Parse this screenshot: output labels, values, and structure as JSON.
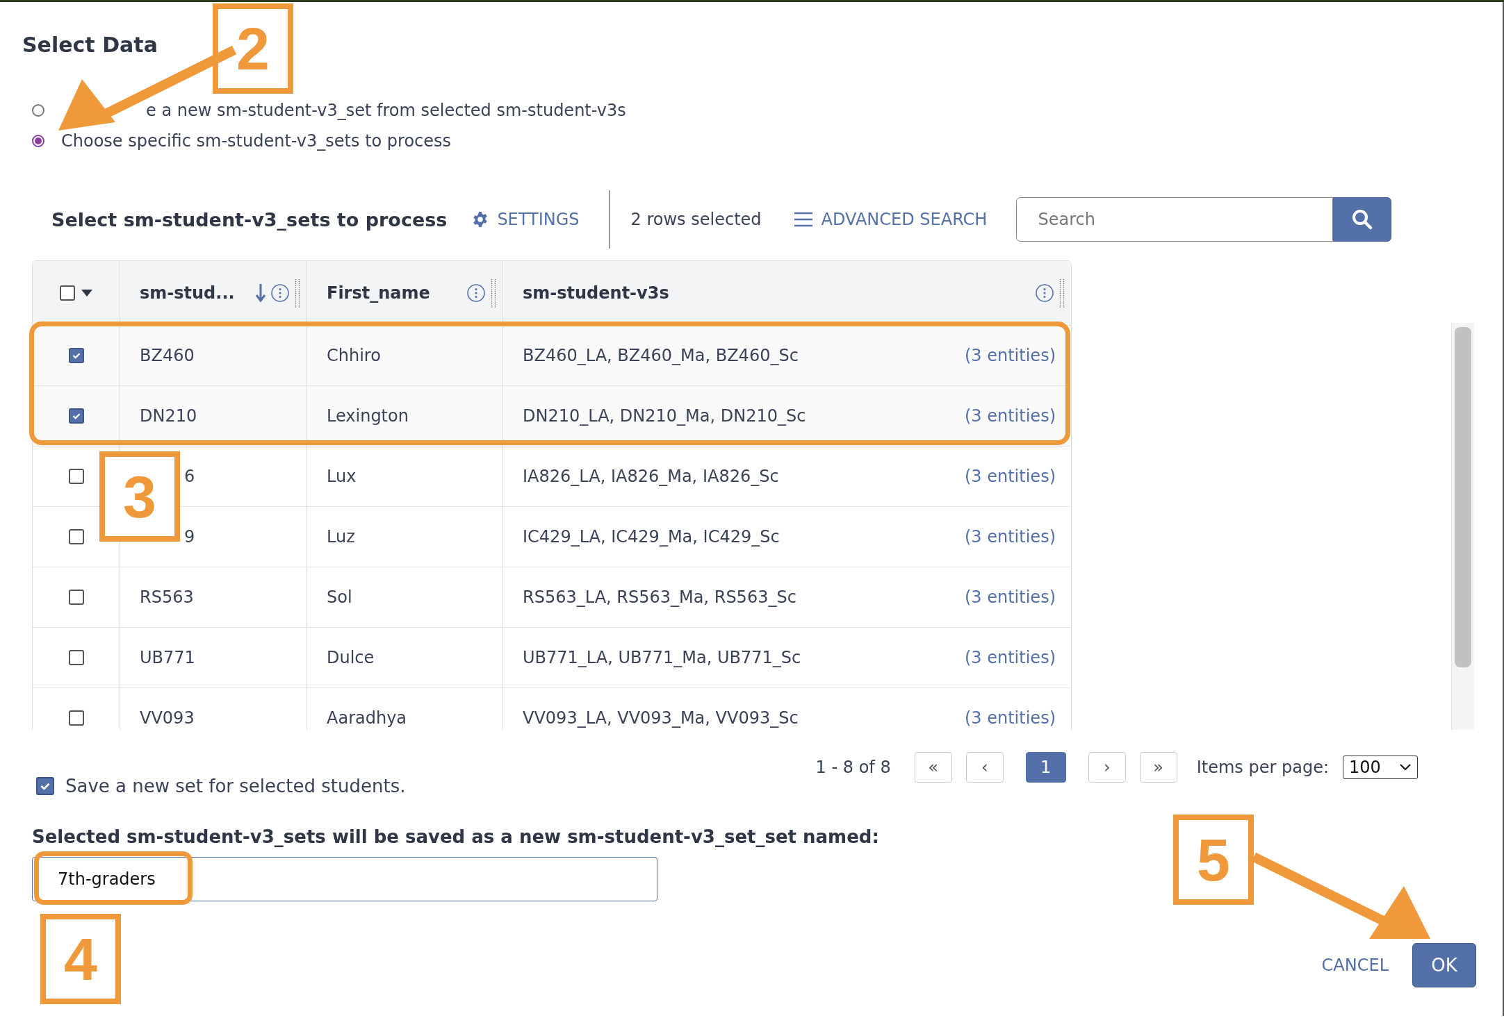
{
  "dialog": {
    "title": "Select Data"
  },
  "options": [
    {
      "label": "e a new sm-student-v3_set from selected sm-student-v3s",
      "selected": false,
      "covered": true
    },
    {
      "label": "Choose specific sm-student-v3_sets to process",
      "selected": true,
      "covered": false
    }
  ],
  "toolbar": {
    "title": "Select sm-student-v3_sets to process",
    "settings": "SETTINGS",
    "selection_count": "2 rows selected",
    "advanced_search": "ADVANCED SEARCH",
    "search": {
      "placeholder": "Search"
    }
  },
  "table": {
    "select_all": false,
    "columns": [
      {
        "label": "sm-stud...",
        "sorted": true
      },
      {
        "label": "First_name",
        "sorted": false
      },
      {
        "label": "sm-student-v3s",
        "sorted": false
      }
    ],
    "rows": [
      {
        "id": "BZ460",
        "first_name": "Chhiro",
        "sets": "BZ460_LA,  BZ460_Ma,  BZ460_Sc",
        "count": "(3 entities)",
        "selected": true,
        "covered": false
      },
      {
        "id": "DN210",
        "first_name": "Lexington",
        "sets": "DN210_LA,  DN210_Ma,  DN210_Sc",
        "count": "(3 entities)",
        "selected": true,
        "covered": false
      },
      {
        "id": "6",
        "first_name": "Lux",
        "sets": "IA826_LA,  IA826_Ma,  IA826_Sc",
        "count": "(3 entities)",
        "selected": false,
        "covered": true
      },
      {
        "id": "9",
        "first_name": "Luz",
        "sets": "IC429_LA,  IC429_Ma,  IC429_Sc",
        "count": "(3 entities)",
        "selected": false,
        "covered": true
      },
      {
        "id": "RS563",
        "first_name": "Sol",
        "sets": "RS563_LA,  RS563_Ma,  RS563_Sc",
        "count": "(3 entities)",
        "selected": false,
        "covered": false
      },
      {
        "id": "UB771",
        "first_name": "Dulce",
        "sets": "UB771_LA,  UB771_Ma,  UB771_Sc",
        "count": "(3 entities)",
        "selected": false,
        "covered": false
      },
      {
        "id": "VV093",
        "first_name": "Aaradhya",
        "sets": "VV093_LA,  VV093_Ma,  VV093_Sc",
        "count": "(3 entities)",
        "selected": false,
        "covered": false
      }
    ]
  },
  "pagination": {
    "range": "1 - 8 of 8",
    "first": "«",
    "prev": "‹",
    "pages": [
      {
        "label": "1",
        "selected": true
      }
    ],
    "next": "›",
    "last": "»",
    "items_per_page_label": "Items per page:",
    "items_per_page": "100"
  },
  "save_set": {
    "label": "Save a new set for selected students.",
    "checked": true
  },
  "name_field": {
    "label": "Selected sm-student-v3_sets will be saved as a new sm-student-v3_set_set named:",
    "value": "7th-graders"
  },
  "buttons": [
    {
      "label": "CANCEL",
      "kind": "text"
    },
    {
      "label": "OK",
      "kind": "primary"
    }
  ],
  "callouts": [
    {
      "label": "2"
    },
    {
      "label": "3"
    },
    {
      "label": "4"
    },
    {
      "label": "5"
    }
  ]
}
